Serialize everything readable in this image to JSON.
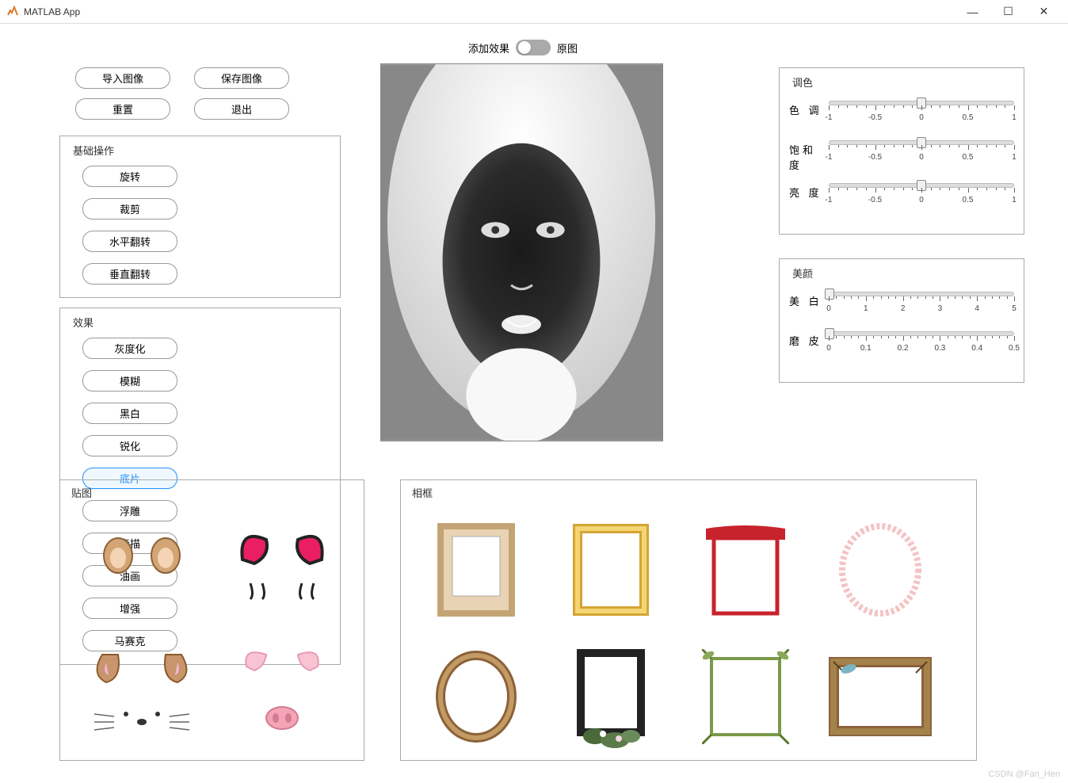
{
  "window": {
    "title": "MATLAB App"
  },
  "toggle": {
    "left_label": "添加效果",
    "right_label": "原图"
  },
  "top_buttons": {
    "import": "导入图像",
    "save": "保存图像",
    "reset": "重置",
    "exit": "退出"
  },
  "basic_ops": {
    "title": "基础操作",
    "rotate": "旋转",
    "crop": "裁剪",
    "hflip": "水平翻转",
    "vflip": "垂直翻转"
  },
  "effects": {
    "title": "效果",
    "grayscale": "灰度化",
    "blur": "模糊",
    "bw": "黑白",
    "sharpen": "锐化",
    "negative": "底片",
    "emboss": "浮雕",
    "sketch": "素描",
    "oil": "油画",
    "enhance": "增强",
    "mosaic": "马赛克",
    "selected": "negative"
  },
  "color_adjust": {
    "title": "调色",
    "hue": {
      "label": "色 调",
      "min": -1,
      "max": 1,
      "value": 0,
      "ticks": [
        "-1",
        "-0.5",
        "0",
        "0.5",
        "1"
      ]
    },
    "saturation": {
      "label": "饱和度",
      "min": -1,
      "max": 1,
      "value": 0,
      "ticks": [
        "-1",
        "-0.5",
        "0",
        "0.5",
        "1"
      ]
    },
    "brightness": {
      "label": "亮 度",
      "min": -1,
      "max": 1,
      "value": 0,
      "ticks": [
        "-1",
        "-0.5",
        "0",
        "0.5",
        "1"
      ]
    }
  },
  "beauty": {
    "title": "美颜",
    "whiten": {
      "label": "美 白",
      "min": 0,
      "max": 5,
      "value": 0,
      "ticks": [
        "0",
        "1",
        "2",
        "3",
        "4",
        "5"
      ]
    },
    "smooth": {
      "label": "磨 皮",
      "min": 0,
      "max": 0.5,
      "value": 0,
      "ticks": [
        "0",
        "0.1",
        "0.2",
        "0.3",
        "0.4",
        "0.5"
      ]
    }
  },
  "stickers": {
    "title": "贴图",
    "items": [
      "cat-ears-1",
      "cat-ears-2",
      "dog-ears",
      "pig-ears-nose"
    ]
  },
  "frames": {
    "title": "相框",
    "items": [
      "frame-classic-beige",
      "frame-gold-ornate",
      "frame-red-chinese",
      "frame-pink-oval",
      "frame-bronze-oval",
      "frame-black-ornate",
      "frame-bamboo",
      "frame-wood-brown"
    ]
  },
  "watermark": "CSDN @Fan_Hen"
}
